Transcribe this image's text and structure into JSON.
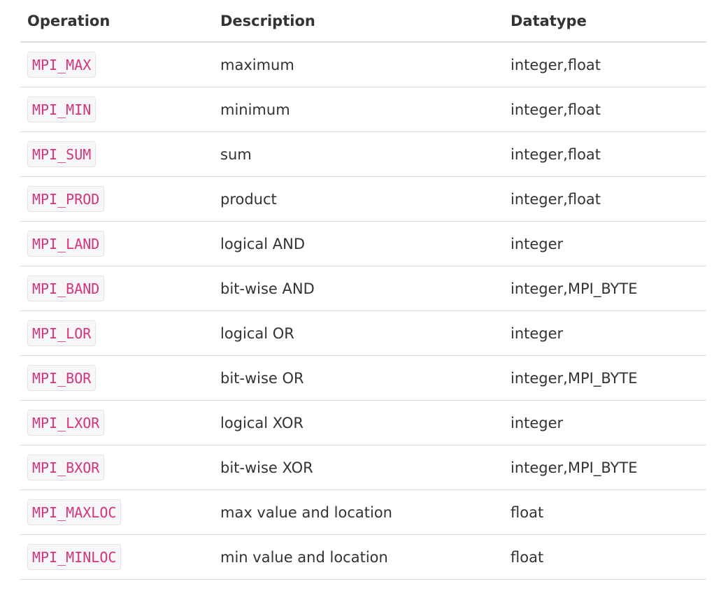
{
  "table": {
    "headers": {
      "operation": "Operation",
      "description": "Description",
      "datatype": "Datatype"
    },
    "rows": [
      {
        "operation": "MPI_MAX",
        "description": "maximum",
        "datatype": "integer,float"
      },
      {
        "operation": "MPI_MIN",
        "description": "minimum",
        "datatype": "integer,float"
      },
      {
        "operation": "MPI_SUM",
        "description": "sum",
        "datatype": "integer,float"
      },
      {
        "operation": "MPI_PROD",
        "description": "product",
        "datatype": "integer,float"
      },
      {
        "operation": "MPI_LAND",
        "description": "logical AND",
        "datatype": "integer"
      },
      {
        "operation": "MPI_BAND",
        "description": "bit-wise AND",
        "datatype": "integer,MPI_BYTE"
      },
      {
        "operation": "MPI_LOR",
        "description": "logical OR",
        "datatype": "integer"
      },
      {
        "operation": "MPI_BOR",
        "description": "bit-wise OR",
        "datatype": "integer,MPI_BYTE"
      },
      {
        "operation": "MPI_LXOR",
        "description": "logical XOR",
        "datatype": "integer"
      },
      {
        "operation": "MPI_BXOR",
        "description": "bit-wise XOR",
        "datatype": "integer,MPI_BYTE"
      },
      {
        "operation": "MPI_MAXLOC",
        "description": "max value and location",
        "datatype": "float"
      },
      {
        "operation": "MPI_MINLOC",
        "description": "min value and location",
        "datatype": "float"
      }
    ]
  },
  "colors": {
    "code_text": "#d6337a",
    "code_background": "#f7f7f9",
    "code_border": "#e1e1e8",
    "row_border": "#dddddd",
    "text": "#333333"
  }
}
